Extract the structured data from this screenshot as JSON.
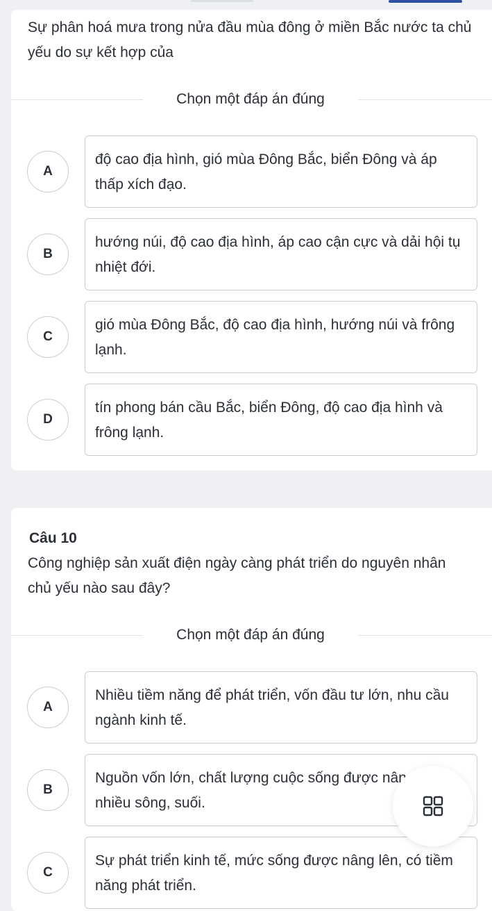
{
  "colors": {
    "background": "#eef0f3",
    "card": "#ffffff",
    "border": "#c9cdd3",
    "progress_active": "#2f4fa3"
  },
  "question_9": {
    "text": "Sự phân hoá mưa trong nửa đầu mùa đông ở miền Bắc nước ta chủ yếu do sự kết hợp của",
    "instruction": "Chọn một đáp án đúng",
    "options": [
      {
        "letter": "A",
        "text": "độ cao địa hình, gió mùa Đông Bắc, biển Đông và áp thấp xích đạo."
      },
      {
        "letter": "B",
        "text": "hướng núi, độ cao địa hình, áp cao cận cực và dải hội tụ nhiệt đới."
      },
      {
        "letter": "C",
        "text": "gió mùa Đông Bắc, độ cao địa hình, hướng núi và frông lạnh."
      },
      {
        "letter": "D",
        "text": "tín phong bán cầu Bắc, biển Đông, độ cao địa hình và frông lạnh."
      }
    ]
  },
  "question_10": {
    "number_label": "Câu 10",
    "text": "Công nghiệp sản xuất điện ngày càng phát triển do nguyên nhân chủ yếu nào sau đây?",
    "instruction": "Chọn một đáp án đúng",
    "options": [
      {
        "letter": "A",
        "text": "Nhiều tiềm năng để phát triển, vốn đầu tư lớn, nhu cầu ngành kinh tế."
      },
      {
        "letter": "B",
        "text": "Nguồn vốn lớn, chất lượng cuộc sống được nâng cao, nhiều sông, suối."
      },
      {
        "letter": "C",
        "text": "Sự phát triển kinh tế, mức sống được nâng lên, có tiềm năng phát triển."
      }
    ]
  },
  "floating_button": {
    "icon": "grid-icon"
  }
}
